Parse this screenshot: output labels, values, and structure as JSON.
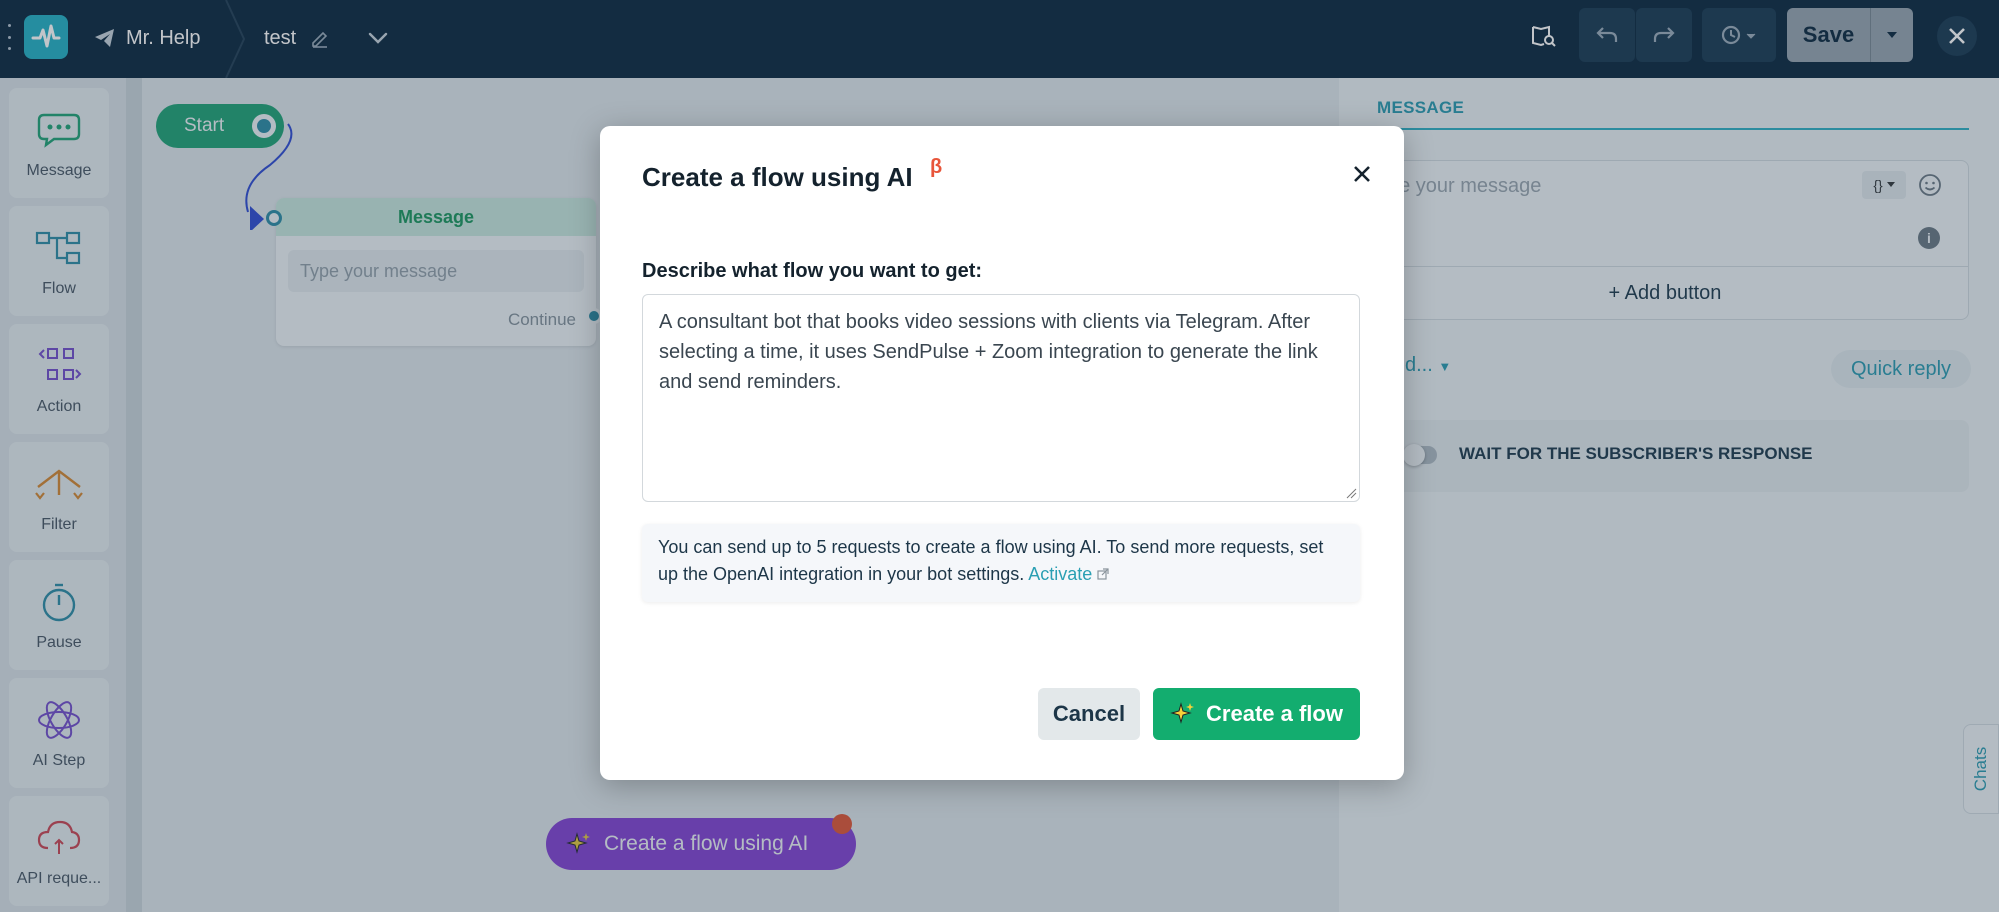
{
  "topbar": {
    "bot_name": "Mr. Help",
    "flow_name": "test",
    "save_label": "Save"
  },
  "sidebar": {
    "items": [
      {
        "label": "Message",
        "icon": "chat-bubble-icon"
      },
      {
        "label": "Flow",
        "icon": "flow-icon"
      },
      {
        "label": "Action",
        "icon": "action-icon"
      },
      {
        "label": "Filter",
        "icon": "filter-icon"
      },
      {
        "label": "Pause",
        "icon": "stopwatch-icon"
      },
      {
        "label": "AI Step",
        "icon": "atom-icon"
      },
      {
        "label": "API reque...",
        "icon": "cloud-api-icon"
      }
    ]
  },
  "canvas": {
    "start_label": "Start",
    "message_node": {
      "header": "Message",
      "placeholder": "Type your message",
      "continue_label": "Continue"
    },
    "ai_button_label": "Create a flow using AI"
  },
  "right_panel": {
    "tab_label": "MESSAGE",
    "message_placeholder": "ype your message",
    "variable_button": "{}",
    "add_button_label": "+ Add button",
    "dropdown_label": "d...",
    "quick_reply_label": "Quick reply",
    "wait_label": "WAIT FOR THE SUBSCRIBER'S RESPONSE",
    "wait_enabled": false
  },
  "chats_tab_label": "Chats",
  "modal": {
    "title": "Create a flow using AI",
    "beta": "β",
    "field_label": "Describe what flow you want to get:",
    "textarea_value": "A consultant bot that books video sessions with clients via Telegram. After selecting a time, it uses SendPulse + Zoom integration to generate the link and send reminders.",
    "note_text": "You can send up to 5 requests to create a flow using AI. To send more requests, set up the OpenAI integration in your bot settings. ",
    "note_link": "Activate",
    "cancel_label": "Cancel",
    "create_label": "Create a flow"
  },
  "colors": {
    "topbar": "#16334a",
    "accent": "#2eb5c8",
    "primary_green": "#13ad6f",
    "ai_purple": "#8b3fd9"
  }
}
